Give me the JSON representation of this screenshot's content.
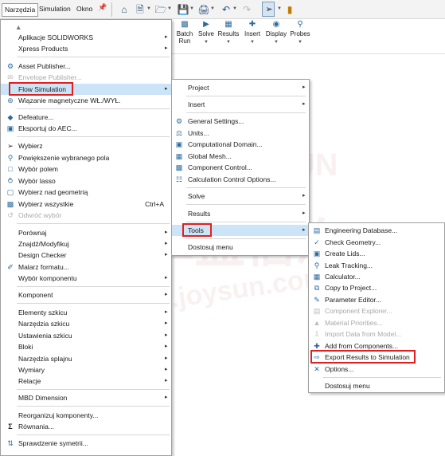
{
  "menubar": {
    "tabs": [
      {
        "label": "Narzędzia",
        "active": true
      },
      {
        "label": "Simulation",
        "active": false
      },
      {
        "label": "Okno",
        "active": false
      }
    ],
    "toolbar_icons": [
      "pin-icon",
      "home-icon",
      "new-document-icon",
      "open-icon",
      "save-icon",
      "print-icon",
      "undo-icon",
      "redo-icon",
      "select-cursor-icon",
      "rebuild-icon"
    ]
  },
  "ribbon": {
    "items": [
      {
        "label": "Batch Run",
        "icon": "batch-run-icon"
      },
      {
        "label": "Solve",
        "icon": "solve-icon"
      },
      {
        "label": "Results",
        "icon": "results-icon"
      },
      {
        "label": "Insert",
        "icon": "insert-icon"
      },
      {
        "label": "Display",
        "icon": "display-icon"
      },
      {
        "label": "Probes",
        "icon": "probes-icon"
      }
    ]
  },
  "main_menu": {
    "items": [
      {
        "label": "Aplikacje SOLIDWORKS",
        "arrow": true
      },
      {
        "label": "Xpress Products",
        "arrow": true
      },
      {
        "label": "Asset Publisher...",
        "icon": "asset-publisher-icon"
      },
      {
        "label": "Envelope Publisher...",
        "disabled": true,
        "icon": "envelope-icon"
      },
      {
        "label": "Flow Simulation",
        "arrow": true,
        "highlighted": true
      },
      {
        "label": "Wiązanie magnetyczne WŁ./WYŁ.",
        "icon": "magnetic-mate-icon"
      },
      {
        "label": "Defeature...",
        "icon": "defeature-icon"
      },
      {
        "label": "Eksportuj do AEC...",
        "icon": "export-aec-icon"
      },
      {
        "label": "Wybierz",
        "icon": "select-icon"
      },
      {
        "label": "Powiększenie wybranego pola",
        "icon": "zoom-box-icon"
      },
      {
        "label": "Wybór polem",
        "icon": "box-select-icon"
      },
      {
        "label": "Wybór lasso",
        "icon": "lasso-icon"
      },
      {
        "label": "Wybierz nad geometrią",
        "icon": "select-over-geometry-icon"
      },
      {
        "label": "Wybierz wszystkie",
        "shortcut": "Ctrl+A",
        "icon": "select-all-icon"
      },
      {
        "label": "Odwróć wybór",
        "disabled": true,
        "icon": "invert-selection-icon"
      },
      {
        "label": "Porównaj",
        "arrow": true
      },
      {
        "label": "Znajdź/Modyfikuj",
        "arrow": true
      },
      {
        "label": "Design Checker",
        "arrow": true
      },
      {
        "label": "Malarz formatu...",
        "icon": "format-painter-icon"
      },
      {
        "label": "Wybór komponentu",
        "arrow": true
      },
      {
        "label": "Komponent",
        "arrow": true
      },
      {
        "label": "Elementy szkicu",
        "arrow": true
      },
      {
        "label": "Narzędzia szkicu",
        "arrow": true
      },
      {
        "label": "Ustawienia szkicu",
        "arrow": true
      },
      {
        "label": "Bloki",
        "arrow": true
      },
      {
        "label": "Narzędzia splajnu",
        "arrow": true
      },
      {
        "label": "Wymiary",
        "arrow": true
      },
      {
        "label": "Relacje",
        "arrow": true
      },
      {
        "label": "MBD Dimension",
        "arrow": true
      },
      {
        "label": "Reorganizuj komponenty..."
      },
      {
        "label": "Równania...",
        "icon": "sigma-icon"
      },
      {
        "label": "Sprawdzenie symetrii...",
        "icon": "symmetry-check-icon"
      }
    ]
  },
  "flow_menu": {
    "items": [
      {
        "label": "Project",
        "arrow": true
      },
      {
        "label": "Insert",
        "arrow": true
      },
      {
        "label": "General Settings...",
        "icon": "general-settings-icon"
      },
      {
        "label": "Units...",
        "icon": "units-icon"
      },
      {
        "label": "Computational Domain...",
        "icon": "computational-domain-icon"
      },
      {
        "label": "Global Mesh...",
        "icon": "global-mesh-icon"
      },
      {
        "label": "Component Control...",
        "icon": "component-control-icon"
      },
      {
        "label": "Calculation Control Options...",
        "icon": "calculation-control-icon"
      },
      {
        "label": "Solve",
        "arrow": true
      },
      {
        "label": "Results",
        "arrow": true
      },
      {
        "label": "Tools",
        "arrow": true,
        "highlighted": true
      },
      {
        "label": "Dostosuj menu"
      }
    ]
  },
  "tools_menu": {
    "items": [
      {
        "label": "Engineering Database...",
        "icon": "engineering-database-icon"
      },
      {
        "label": "Check Geometry...",
        "icon": "check-geometry-icon"
      },
      {
        "label": "Create Lids...",
        "icon": "create-lids-icon"
      },
      {
        "label": "Leak Tracking...",
        "icon": "leak-tracking-icon"
      },
      {
        "label": "Calculator...",
        "icon": "calculator-icon"
      },
      {
        "label": "Copy to Project...",
        "icon": "copy-to-project-icon"
      },
      {
        "label": "Parameter Editor...",
        "icon": "parameter-editor-icon"
      },
      {
        "label": "Component Explorer...",
        "disabled": true,
        "icon": "component-explorer-icon"
      },
      {
        "label": "Material Priorities...",
        "disabled": true,
        "icon": "material-priorities-icon"
      },
      {
        "label": "Import Data from Model...",
        "disabled": true,
        "icon": "import-data-icon"
      },
      {
        "label": "Add from Components...",
        "icon": "add-from-components-icon"
      },
      {
        "label": "Export Results to Simulation",
        "icon": "export-results-icon",
        "boxed": true
      },
      {
        "label": "Options...",
        "icon": "options-icon"
      },
      {
        "label": "Dostosuj menu"
      }
    ]
  },
  "watermark": {
    "text_latin": "JOYSUN",
    "text_cn": "卓盛信息",
    "text_url": "sw.joysun.com"
  },
  "colors": {
    "highlight_box": "#e0201f",
    "hover": "#cce4f7",
    "disabled_text": "#a8a8a8"
  }
}
